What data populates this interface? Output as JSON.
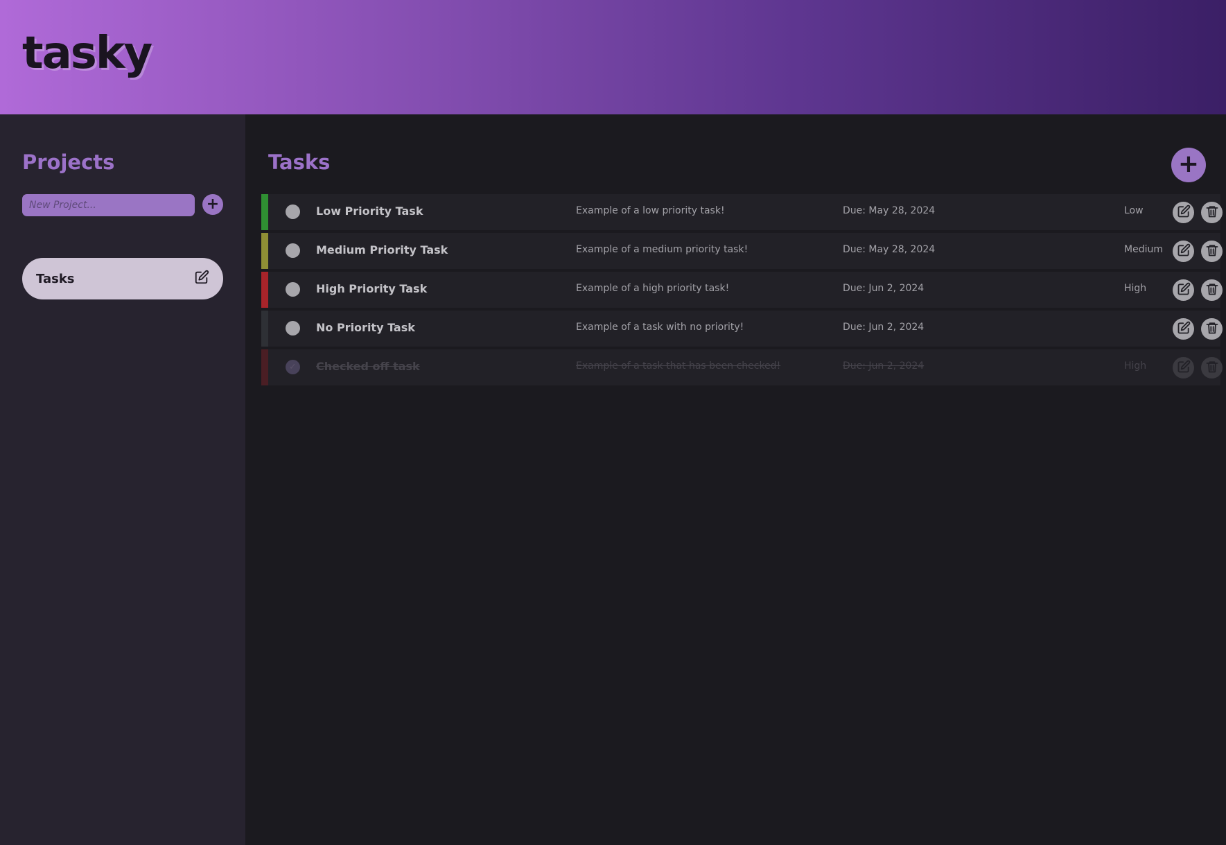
{
  "app": {
    "logo": "tasky"
  },
  "colors": {
    "accent": "#9a75c4",
    "low": "#2f8f32",
    "medium": "#8f8f35",
    "high": "#a8242a",
    "none": "#2e3035",
    "checked_high": "#4a1e24"
  },
  "sidebar": {
    "title": "Projects",
    "new_project_placeholder": "New Project...",
    "add_project_icon": "plus-icon",
    "projects": [
      {
        "label": "Tasks",
        "edit_icon": "edit-icon"
      }
    ]
  },
  "main": {
    "title": "Tasks",
    "add_task_icon": "plus-icon",
    "tasks": [
      {
        "name": "Low Priority Task",
        "description": "Example of a low priority task!",
        "due": "Due: May 28, 2024",
        "priority": "Low",
        "checked": false
      },
      {
        "name": "Medium Priority Task",
        "description": "Example of a medium priority task!",
        "due": "Due: May 28, 2024",
        "priority": "Medium",
        "checked": false
      },
      {
        "name": "High Priority Task",
        "description": "Example of a high priority task!",
        "due": "Due: Jun 2, 2024",
        "priority": "High",
        "checked": false
      },
      {
        "name": "No Priority Task",
        "description": "Example of a task with no priority!",
        "due": "Due: Jun 2, 2024",
        "priority": "",
        "checked": false
      },
      {
        "name": "Checked off task",
        "description": "Example of a task that has been checked!",
        "due": "Due: Jun 2, 2024",
        "priority": "High",
        "checked": true
      }
    ]
  }
}
